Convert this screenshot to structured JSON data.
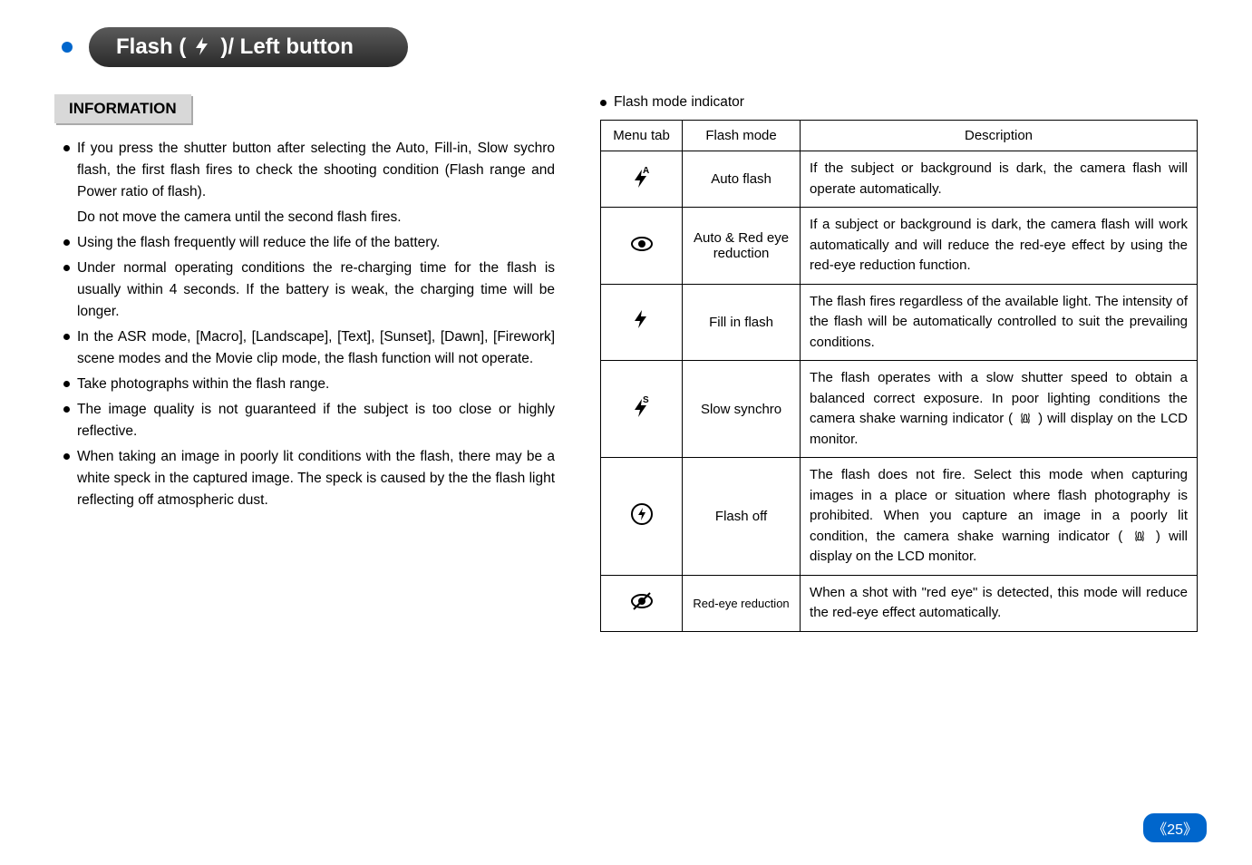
{
  "title": {
    "prefix": "Flash (",
    "suffix": ")/ Left button"
  },
  "info": {
    "heading": "INFORMATION",
    "items": [
      "If you press the shutter button after selecting the Auto, Fill-in, Slow sychro flash, the first flash fires to check the shooting condition (Flash range and Power ratio of flash).",
      "Using the flash frequently will reduce the life of the battery.",
      "Under normal operating conditions the re-charging time for the flash is usually within 4 seconds. If the battery is weak, the charging time will be longer.",
      "In the ASR mode, [Macro], [Landscape], [Text], [Sunset], [Dawn], [Firework] scene modes and the Movie clip mode, the flash function will not operate.",
      "Take photographs within the flash range.",
      "The image quality is not guaranteed if the subject is too close or highly reflective.",
      "When taking an image in poorly lit conditions with the flash, there may be a white speck in the captured image. The speck is caused by the the flash light reflecting off atmospheric dust."
    ],
    "subline_after_first": "Do not move the camera until the second flash fires."
  },
  "right": {
    "header": "Flash mode indicator",
    "table_headers": {
      "menu": "Menu tab",
      "mode": "Flash mode",
      "desc": "Description"
    },
    "rows": [
      {
        "icon": "flash-auto",
        "mode": "Auto flash",
        "desc": "If the subject or background is dark, the camera flash will operate automatically."
      },
      {
        "icon": "red-eye",
        "mode": "Auto & Red eye reduction",
        "desc": "If a subject or background is dark, the camera flash will work automatically and will reduce the red-eye effect by using the red-eye reduction function."
      },
      {
        "icon": "fill-flash",
        "mode": "Fill in flash",
        "desc": "The flash fires regardless of the available light. The intensity of the flash will be automatically controlled to suit the prevailing conditions."
      },
      {
        "icon": "slow-sync",
        "mode": "Slow synchro",
        "desc_pre": "The flash operates with a slow shutter speed to obtain a balanced correct exposure. In poor lighting conditions the camera shake warning indicator ( ",
        "desc_post": " ) will display on the LCD monitor."
      },
      {
        "icon": "flash-off",
        "mode": "Flash off",
        "desc_pre": "The flash does not fire. Select this mode when capturing images in a place or situation where flash photography is prohibited. When you capture an image in a poorly lit condition, the camera shake warning indicator ( ",
        "desc_post": " ) will display on the LCD monitor."
      },
      {
        "icon": "red-eye-fix",
        "mode": "Red-eye reduction",
        "desc": "When a shot with \"red eye\" is detected, this mode will reduce the red-eye effect automatically."
      }
    ]
  },
  "page": "《25》"
}
